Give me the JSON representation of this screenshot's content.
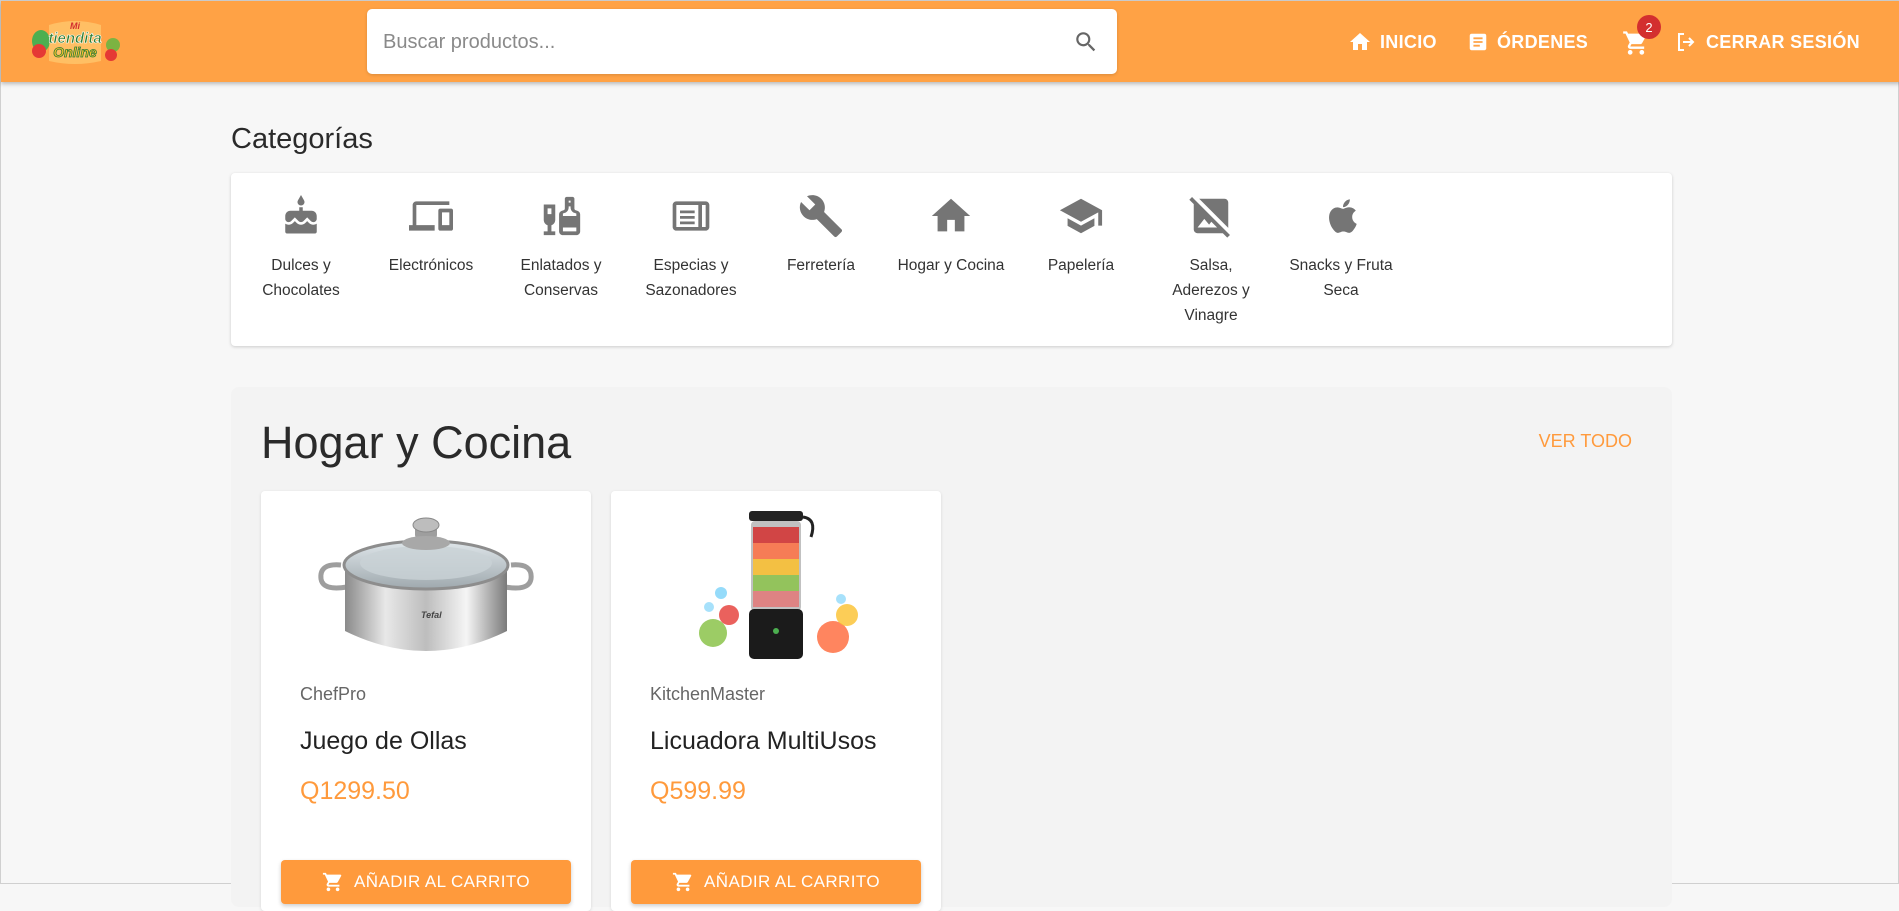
{
  "brand": {
    "logo_top": "Mi",
    "logo_mid": "tiendita",
    "logo_bottom": "Online"
  },
  "search": {
    "placeholder": "Buscar productos...",
    "icon": "search-icon"
  },
  "nav": {
    "home_label": "INICIO",
    "orders_label": "ÓRDENES",
    "cart_count": "2",
    "logout_label": "CERRAR SESIÓN"
  },
  "categories": {
    "title": "Categorías",
    "items": [
      {
        "label": "Dulces y Chocolates",
        "icon": "cake-icon"
      },
      {
        "label": "Electrónicos",
        "icon": "devices-icon"
      },
      {
        "label": "Enlatados y Conservas",
        "icon": "liquor-icon"
      },
      {
        "label": "Especias y Sazonadores",
        "icon": "microwave-icon"
      },
      {
        "label": "Ferretería",
        "icon": "wrench-icon"
      },
      {
        "label": "Hogar y Cocina",
        "icon": "home-icon"
      },
      {
        "label": "Papelería",
        "icon": "school-icon"
      },
      {
        "label": "Salsa, Aderezos y Vinagre",
        "icon": "image-not-supported-icon"
      },
      {
        "label": "Snacks y Fruta Seca",
        "icon": "apple-icon"
      }
    ]
  },
  "section": {
    "title": "Hogar y Cocina",
    "see_all": "VER TODO",
    "products": [
      {
        "brand": "ChefPro",
        "name": "Juego de Ollas",
        "price": "Q1299.50",
        "button": "AÑADIR AL CARRITO",
        "image": "cooking-pot"
      },
      {
        "brand": "KitchenMaster",
        "name": "Licuadora MultiUsos",
        "price": "Q599.99",
        "button": "AÑADIR AL CARRITO",
        "image": "portable-blender"
      }
    ]
  },
  "colors": {
    "primary": "#ffa245",
    "accent": "#ff9a3c",
    "badge": "#d32f2f"
  }
}
